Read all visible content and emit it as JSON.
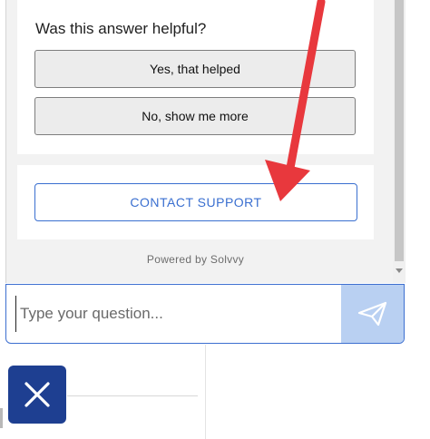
{
  "feedback": {
    "question": "Was this answer helpful?",
    "yes_label": "Yes, that helped",
    "no_label": "No, show me more"
  },
  "contact": {
    "button_label": "CONTACT SUPPORT"
  },
  "footer": {
    "powered_by": "Powered by Solvvy"
  },
  "input": {
    "placeholder": "Type your question...",
    "value": ""
  },
  "icons": {
    "send": "paper-plane-icon",
    "close": "close-icon",
    "annotation": "red-arrow-annotation"
  },
  "colors": {
    "accent": "#3a6fd0",
    "send_bg": "#b9d0f2",
    "launcher_bg": "#1e3f91",
    "annotation": "#e8383d"
  }
}
